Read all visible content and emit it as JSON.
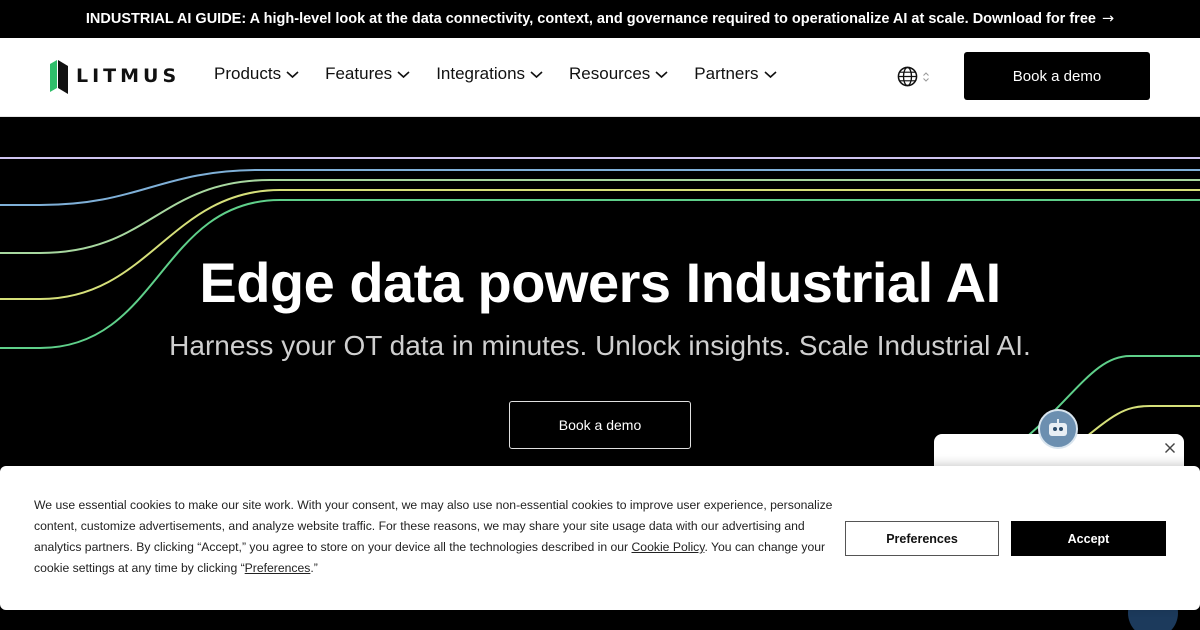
{
  "banner": {
    "text": "INDUSTRIAL AI GUIDE: A high-level look at the data connectivity, context, and governance required to operationalize AI at scale. Download for free",
    "arrow": "→"
  },
  "nav": {
    "logo_text": "LITMUS",
    "menu": [
      {
        "label": "Products"
      },
      {
        "label": "Features"
      },
      {
        "label": "Integrations"
      },
      {
        "label": "Resources"
      },
      {
        "label": "Partners"
      }
    ],
    "cta": "Book a demo"
  },
  "hero": {
    "title": "Edge data powers Industrial AI",
    "subtitle": "Harness your OT data in minutes. Unlock insights. Scale Industrial AI.",
    "cta": "Book a demo"
  },
  "chat": {
    "close_icon": "close-icon"
  },
  "cookie": {
    "text_1": "We use essential cookies to make our site work. With your consent, we may also use non-essential cookies to improve user experience, personalize content, customize advertisements, and analyze website traffic. For these reasons, we may share your site usage data with our advertising and analytics partners. By clicking “Accept,” you agree to store on your device all the technologies described in our ",
    "policy_link": "Cookie Policy",
    "text_2": ". You can change your cookie settings at any time by clicking “",
    "preferences_link": "Preferences",
    "text_3": ".”",
    "preferences_button": "Preferences",
    "accept_button": "Accept"
  },
  "colors": {
    "line_1": "#cfc4f0",
    "line_2": "#7fb0d8",
    "line_3": "#a8d8a0",
    "line_4": "#d6e07a",
    "line_5": "#5fd08a"
  }
}
